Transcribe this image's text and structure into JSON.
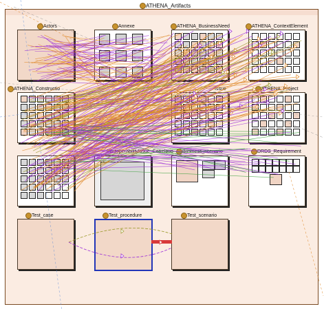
{
  "diagram": {
    "package_title": "ATHENA_Artifacts",
    "packages": [
      {
        "id": "actors",
        "label": "Actors",
        "fill": "pink",
        "minis": []
      },
      {
        "id": "annexe",
        "label": "Annexe",
        "fill": "white",
        "minis": "grid3"
      },
      {
        "id": "athena-businessneed",
        "label": "ATHENA_BusinessNeed",
        "fill": "white",
        "minis": "grid4"
      },
      {
        "id": "athena-contextelement",
        "label": "ATHENA_ContextElement",
        "fill": "white",
        "minis": "grid4"
      },
      {
        "id": "athena-constructions",
        "label": "ATHENA_Constructio",
        "fill": "white",
        "minis": "grid5"
      },
      {
        "id": "athena-issue",
        "label": "Issue",
        "fill": "white",
        "minis": "grid5"
      },
      {
        "id": "athena-project",
        "label": "ATHENA_Project",
        "fill": "white",
        "minis": "grid5pk"
      },
      {
        "id": "box-row3-col1",
        "label": "",
        "fill": "white",
        "minis": "grid3"
      },
      {
        "id": "interoperability-issue-correlation",
        "label": "InteroperabilityIssue_Correlatio",
        "fill": "grey",
        "minis": []
      },
      {
        "id": "business-scenario",
        "label": "Business_scenario",
        "fill": "white",
        "minis": "pair"
      },
      {
        "id": "drds-requirement",
        "label": "DRDS_Requirement",
        "fill": "white",
        "minis": "drds"
      },
      {
        "id": "test-case",
        "label": "Test_case",
        "fill": "pink",
        "minis": []
      },
      {
        "id": "test-procedure",
        "label": "Test_procedure",
        "fill": "pink",
        "minis": [],
        "selected": true
      },
      {
        "id": "test-scenario",
        "label": "Test_scenario",
        "fill": "pink",
        "minis": []
      }
    ],
    "edge_colors": {
      "orange": "#e08a2a",
      "purple": "#9a2ad8",
      "olive": "#9a9a2a",
      "green": "#3aa03a",
      "grey": "#8a8a8a",
      "blue": "#5a8ad8",
      "red": "#d83a3a"
    }
  }
}
